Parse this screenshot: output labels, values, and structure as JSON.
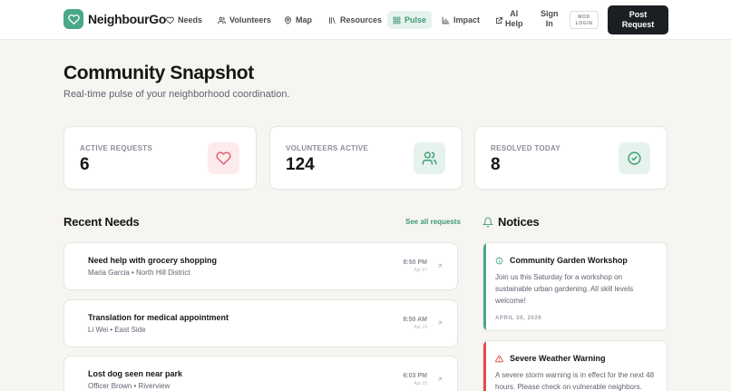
{
  "app": {
    "name": "NeighbourGo",
    "accent": "#4aa886",
    "alert": "#e24c4c"
  },
  "nav": {
    "items": [
      {
        "label": "Needs",
        "icon": "heart-icon"
      },
      {
        "label": "Volunteers",
        "icon": "users-icon"
      },
      {
        "label": "Map",
        "icon": "map-pin-icon"
      },
      {
        "label": "Resources",
        "icon": "library-icon"
      },
      {
        "label": "Pulse",
        "icon": "grid-icon",
        "active": true
      },
      {
        "label": "Impact",
        "icon": "bar-chart-icon"
      }
    ],
    "ai_help": {
      "line1": "AI",
      "line2": "Help",
      "icon": "share-icon"
    },
    "sign_in": {
      "line1": "Sign",
      "line2": "In"
    },
    "mod_login": {
      "line1": "MOD",
      "line2": "LOGIN"
    },
    "post_request": {
      "line1": "Post",
      "line2": "Request"
    }
  },
  "page": {
    "title": "Community Snapshot",
    "subtitle": "Real-time pulse of your neighborhood coordination."
  },
  "stats": [
    {
      "label": "ACTIVE REQUESTS",
      "value": "6",
      "icon": "heart-icon",
      "color": "#e05a6a"
    },
    {
      "label": "VOLUNTEERS ACTIVE",
      "value": "124",
      "icon": "users-icon",
      "color": "#3d9a76"
    },
    {
      "label": "RESOLVED TODAY",
      "value": "8",
      "icon": "check-circle-icon",
      "color": "#3d9a76"
    }
  ],
  "recent_needs": {
    "title": "Recent Needs",
    "see_all": "See all requests",
    "items": [
      {
        "title": "Need help with grocery shopping",
        "meta": "Maria Garcia • North Hill District",
        "time": "8:50 PM",
        "date": "Apr 27"
      },
      {
        "title": "Translation for medical appointment",
        "meta": "Li Wei • East Side",
        "time": "8:50 AM",
        "date": "Apr 29"
      },
      {
        "title": "Lost dog seen near park",
        "meta": "Officer Brown • Riverview",
        "time": "6:03 PM",
        "date": "Apr 29"
      }
    ]
  },
  "notices": {
    "title": "Notices",
    "items": [
      {
        "title": "Community Garden Workshop",
        "body": "Join us this Saturday for a workshop on sustainable urban gardening. All skill levels welcome!",
        "date": "APRIL 30, 2026",
        "icon": "info-icon",
        "color": "#4aa886"
      },
      {
        "title": "Severe Weather Warning",
        "body": "A severe storm warning is in effect for the next 48 hours. Please check on vulnerable neighbors.",
        "date": "",
        "icon": "alert-triangle-icon",
        "color": "#e24c4c"
      }
    ]
  }
}
